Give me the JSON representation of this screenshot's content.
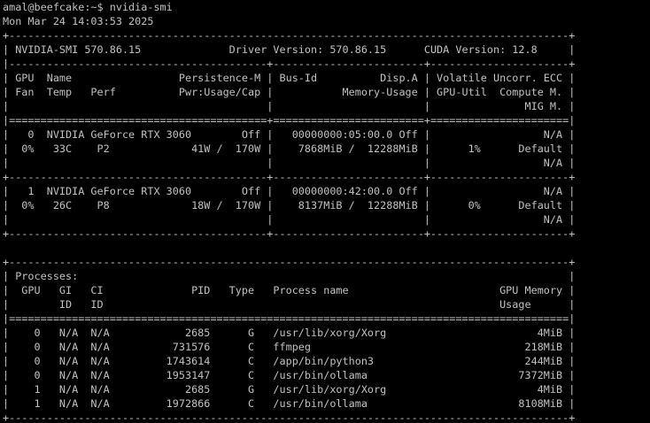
{
  "colors": {
    "background": "#000000",
    "foreground": "#c0c0c0"
  },
  "terminal": {
    "prompt": "amal@beefcake:~$ nvidia-smi",
    "lines": [
      "Mon Mar 24 14:03:53 2025",
      "+-----------------------------------------------------------------------------------------+",
      "| NVIDIA-SMI 570.86.15              Driver Version: 570.86.15      CUDA Version: 12.8     |",
      "|-----------------------------------------+------------------------+----------------------+",
      "| GPU  Name                 Persistence-M | Bus-Id          Disp.A | Volatile Uncorr. ECC |",
      "| Fan  Temp   Perf          Pwr:Usage/Cap |           Memory-Usage | GPU-Util  Compute M. |",
      "|                                         |                        |               MIG M. |",
      "|=========================================+========================+======================|",
      "|   0  NVIDIA GeForce RTX 3060        Off |   00000000:05:00.0 Off |                  N/A |",
      "|  0%   33C    P2             41W /  170W |    7868MiB /  12288MiB |      1%      Default |",
      "|                                         |                        |                  N/A |",
      "+-----------------------------------------+------------------------+----------------------+",
      "|   1  NVIDIA GeForce RTX 3060        Off |   00000000:42:00.0 Off |                  N/A |",
      "|  0%   26C    P8             18W /  170W |    8137MiB /  12288MiB |      0%      Default |",
      "|                                         |                        |                  N/A |",
      "+-----------------------------------------+------------------------+----------------------+",
      "",
      "+-----------------------------------------------------------------------------------------+",
      "| Processes:                                                                              |",
      "|  GPU   GI   CI              PID   Type   Process name                        GPU Memory |",
      "|        ID   ID                                                               Usage      |",
      "|=========================================================================================|",
      "|    0   N/A  N/A            2685      G   /usr/lib/xorg/Xorg                        4MiB |",
      "|    0   N/A  N/A          731576      C   ffmpeg                                  218MiB |",
      "|    0   N/A  N/A         1743614      C   /app/bin/python3                        244MiB |",
      "|    0   N/A  N/A         1953147      C   /usr/bin/ollama                        7372MiB |",
      "|    1   N/A  N/A            2685      G   /usr/lib/xorg/Xorg                        4MiB |",
      "|    1   N/A  N/A         1972866      C   /usr/bin/ollama                        8108MiB |",
      "+-----------------------------------------------------------------------------------------+"
    ]
  }
}
